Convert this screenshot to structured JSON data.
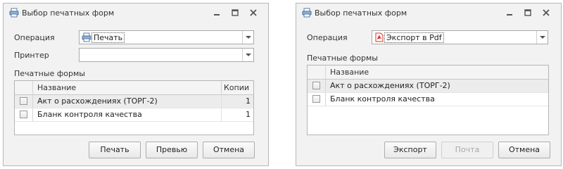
{
  "dialogs": [
    {
      "title": "Выбор печатных форм",
      "operation_label": "Операция",
      "operation_value": "Печать",
      "operation_icon": "printer-icon",
      "printer_label": "Принтер",
      "printer_value": "",
      "forms_label": "Печатные формы",
      "columns": [
        "Название",
        "Копии"
      ],
      "rows": [
        {
          "name": "Акт о расхождениях (ТОРГ-2)",
          "copies": "1",
          "checked": false,
          "selected": true
        },
        {
          "name": "Бланк контроля качества",
          "copies": "1",
          "checked": false,
          "selected": false
        }
      ],
      "buttons": {
        "print": "Печать",
        "preview": "Превью",
        "cancel": "Отмена"
      }
    },
    {
      "title": "Выбор печатных форм",
      "operation_label": "Операция",
      "operation_value": "Экспорт в Pdf",
      "operation_icon": "pdf-icon",
      "forms_label": "Печатные формы",
      "columns": [
        "Название"
      ],
      "rows": [
        {
          "name": "Акт о расхождениях (ТОРГ-2)",
          "checked": false,
          "selected": true
        },
        {
          "name": "Бланк контроля качества",
          "checked": false,
          "selected": false
        }
      ],
      "buttons": {
        "export": "Экспорт",
        "mail": "Почта",
        "cancel": "Отмена"
      },
      "disabled_buttons": [
        "mail"
      ]
    }
  ],
  "colors": {
    "pdf_red": "#d8322a",
    "printer_blue": "#3a6fb0"
  }
}
